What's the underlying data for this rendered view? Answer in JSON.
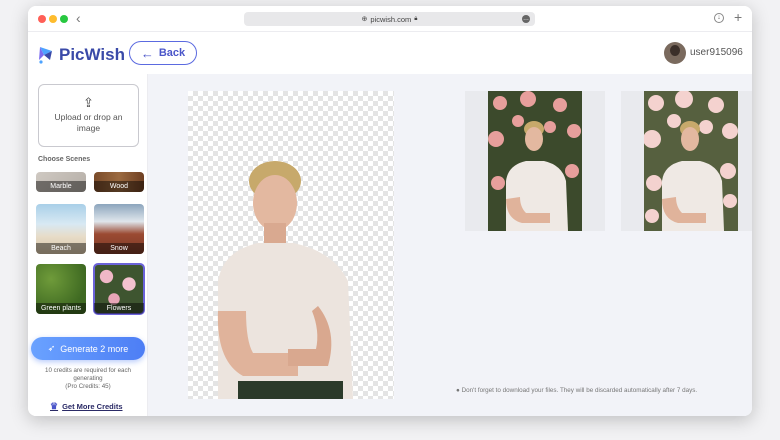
{
  "browser": {
    "url": "picwish.com",
    "lock_icon": "lock-icon",
    "globe_icon": "globe-icon",
    "more_icon": "more-icon",
    "download_icon": "download-icon",
    "new_tab_icon": "plus-icon",
    "back_icon": "chevron-left-icon"
  },
  "header": {
    "logo_text": "PicWish",
    "back_label": "Back",
    "username": "user915096"
  },
  "sidebar": {
    "upload_text": "Upload or drop an image",
    "scenes_title": "Choose Scenes",
    "scenes": [
      {
        "label": "Marble",
        "selected": false
      },
      {
        "label": "Wood",
        "selected": false
      },
      {
        "label": "Beach",
        "selected": false
      },
      {
        "label": "Snow",
        "selected": false
      },
      {
        "label": "Green plants",
        "selected": false
      },
      {
        "label": "Flowers",
        "selected": true
      }
    ],
    "generate_label": "Generate 2 more",
    "credits_note": "10 credits are required for each generating",
    "pro_credits": "(Pro Credits: 45)",
    "get_credits_label": "Get More Credits"
  },
  "main": {
    "notice": "Don't forget to download your files. They will be discarded automatically after 7 days."
  },
  "colors": {
    "brand": "#3a4aa8",
    "accent": "#5b6ae0",
    "generate_button": "#4d7ef5",
    "selected_outline": "#6b63d9"
  }
}
